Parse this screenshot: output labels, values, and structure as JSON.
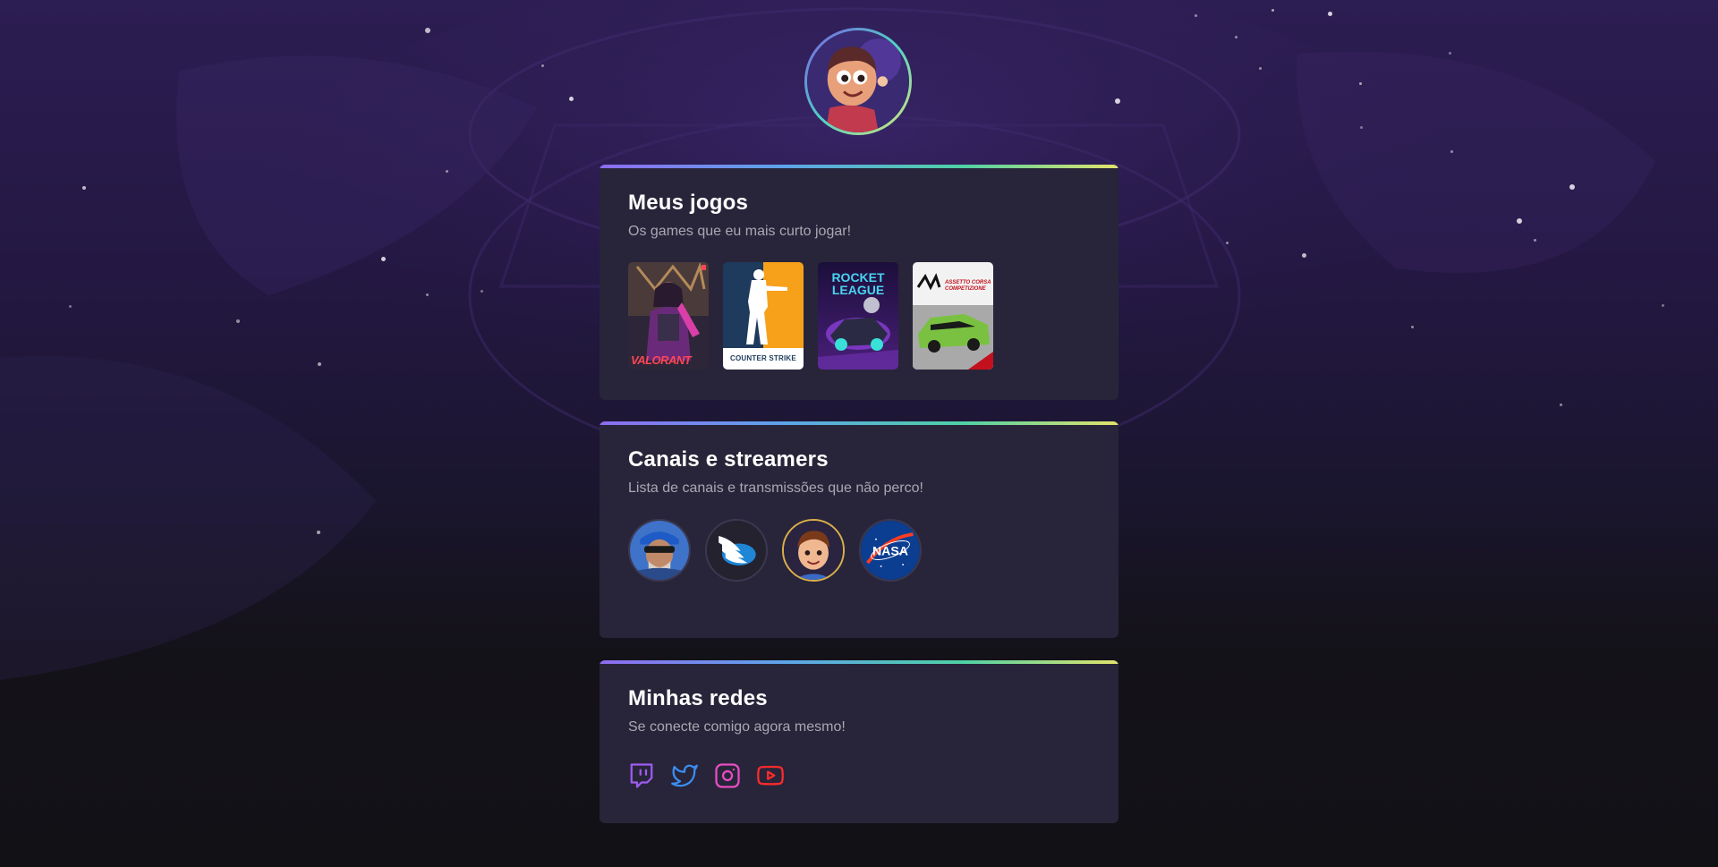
{
  "profile": {
    "avatar_icon": "gamer-avatar-icon"
  },
  "games_card": {
    "title": "Meus jogos",
    "subtitle": "Os games que eu mais curto jogar!",
    "games": [
      {
        "name": "valorant",
        "cover_text": "VALORANT",
        "icon": "valorant-cover"
      },
      {
        "name": "counter-strike",
        "cover_text": "COUNTER STRIKE",
        "icon": "counter-strike-cover"
      },
      {
        "name": "rocket-league",
        "cover_text": "ROCKET LEAGUE",
        "icon": "rocket-league-cover"
      },
      {
        "name": "assetto-corsa",
        "cover_text": "ASSETTO CORSA COMPETIZIONE",
        "icon": "assetto-corsa-cover"
      }
    ]
  },
  "streamers_card": {
    "title": "Canais e streamers",
    "subtitle": "Lista de canais e transmissões que não perco!",
    "streamers": [
      {
        "name": "streamer-1",
        "icon": "streamer-photo"
      },
      {
        "name": "streamer-2",
        "icon": "winged-logo"
      },
      {
        "name": "streamer-3",
        "icon": "cartoon-avatar"
      },
      {
        "name": "nasa",
        "icon": "nasa-logo"
      }
    ]
  },
  "socials_card": {
    "title": "Minhas redes",
    "subtitle": "Se conecte comigo agora mesmo!",
    "links": [
      {
        "name": "twitch",
        "icon": "twitch-icon",
        "color": "#9147ff"
      },
      {
        "name": "twitter",
        "icon": "twitter-icon",
        "color": "#1d9bf0"
      },
      {
        "name": "instagram",
        "icon": "instagram-icon",
        "color": "#e84dc2"
      },
      {
        "name": "youtube",
        "icon": "youtube-icon",
        "color": "#ff1d1d"
      }
    ]
  },
  "colors": {
    "card_bg": "#28253a",
    "accent_gradient": [
      "#8e6cf0",
      "#5ea3ea",
      "#4fd1a5",
      "#e2e36b"
    ],
    "title": "#ffffff",
    "subtitle": "#a8a8b3"
  }
}
